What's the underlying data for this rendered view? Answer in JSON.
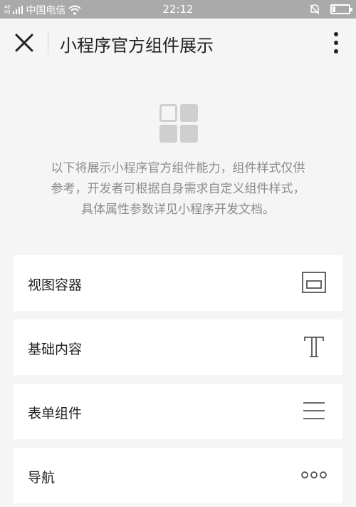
{
  "status_bar": {
    "signal_top": "4G",
    "signal_bottom": "HD",
    "carrier": "中国电信",
    "time": "22:12",
    "battery_level": 0.2
  },
  "nav": {
    "title": "小程序官方组件展示"
  },
  "intro": {
    "lines": [
      "以下将展示小程序官方组件能力，组件样式仅供",
      "参考，开发者可根据自身需求自定义组件样式，",
      "具体属性参数详见小程序开发文档。"
    ]
  },
  "menu": {
    "items": [
      {
        "label": "视图容器",
        "icon": "view-container-icon"
      },
      {
        "label": "基础内容",
        "icon": "text-t-icon"
      },
      {
        "label": "表单组件",
        "icon": "lines-icon"
      },
      {
        "label": "导航",
        "icon": "three-dots-icon"
      }
    ]
  },
  "colors": {
    "status_bar_bg": "#aaaaaa",
    "page_bg": "#f5f5f5",
    "card_bg": "#ffffff",
    "intro_text": "#8c8c8c",
    "icon_gray": "#555555"
  }
}
